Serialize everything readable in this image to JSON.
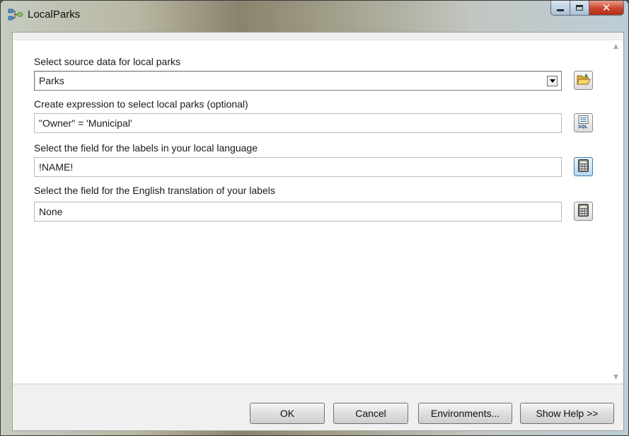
{
  "window": {
    "title": "LocalParks"
  },
  "form": {
    "source_label": "Select source data for local parks",
    "source_value": "Parks",
    "expression_label": "Create expression to select local parks (optional)",
    "expression_value": "\"Owner\" = 'Municipal'",
    "label_field_label": "Select the field for the labels in your local language",
    "label_field_value": "!NAME!",
    "english_field_label": "Select the field for the English translation of your labels",
    "english_field_value": "None"
  },
  "icons": {
    "browse": "folder-open-icon",
    "sql": "sql-icon",
    "calculator": "calculator-icon"
  },
  "buttons": {
    "ok": "OK",
    "cancel": "Cancel",
    "environments": "Environments...",
    "show_help": "Show Help >>"
  },
  "colors": {
    "accent": "#3c7fb1",
    "close": "#c9432c"
  }
}
